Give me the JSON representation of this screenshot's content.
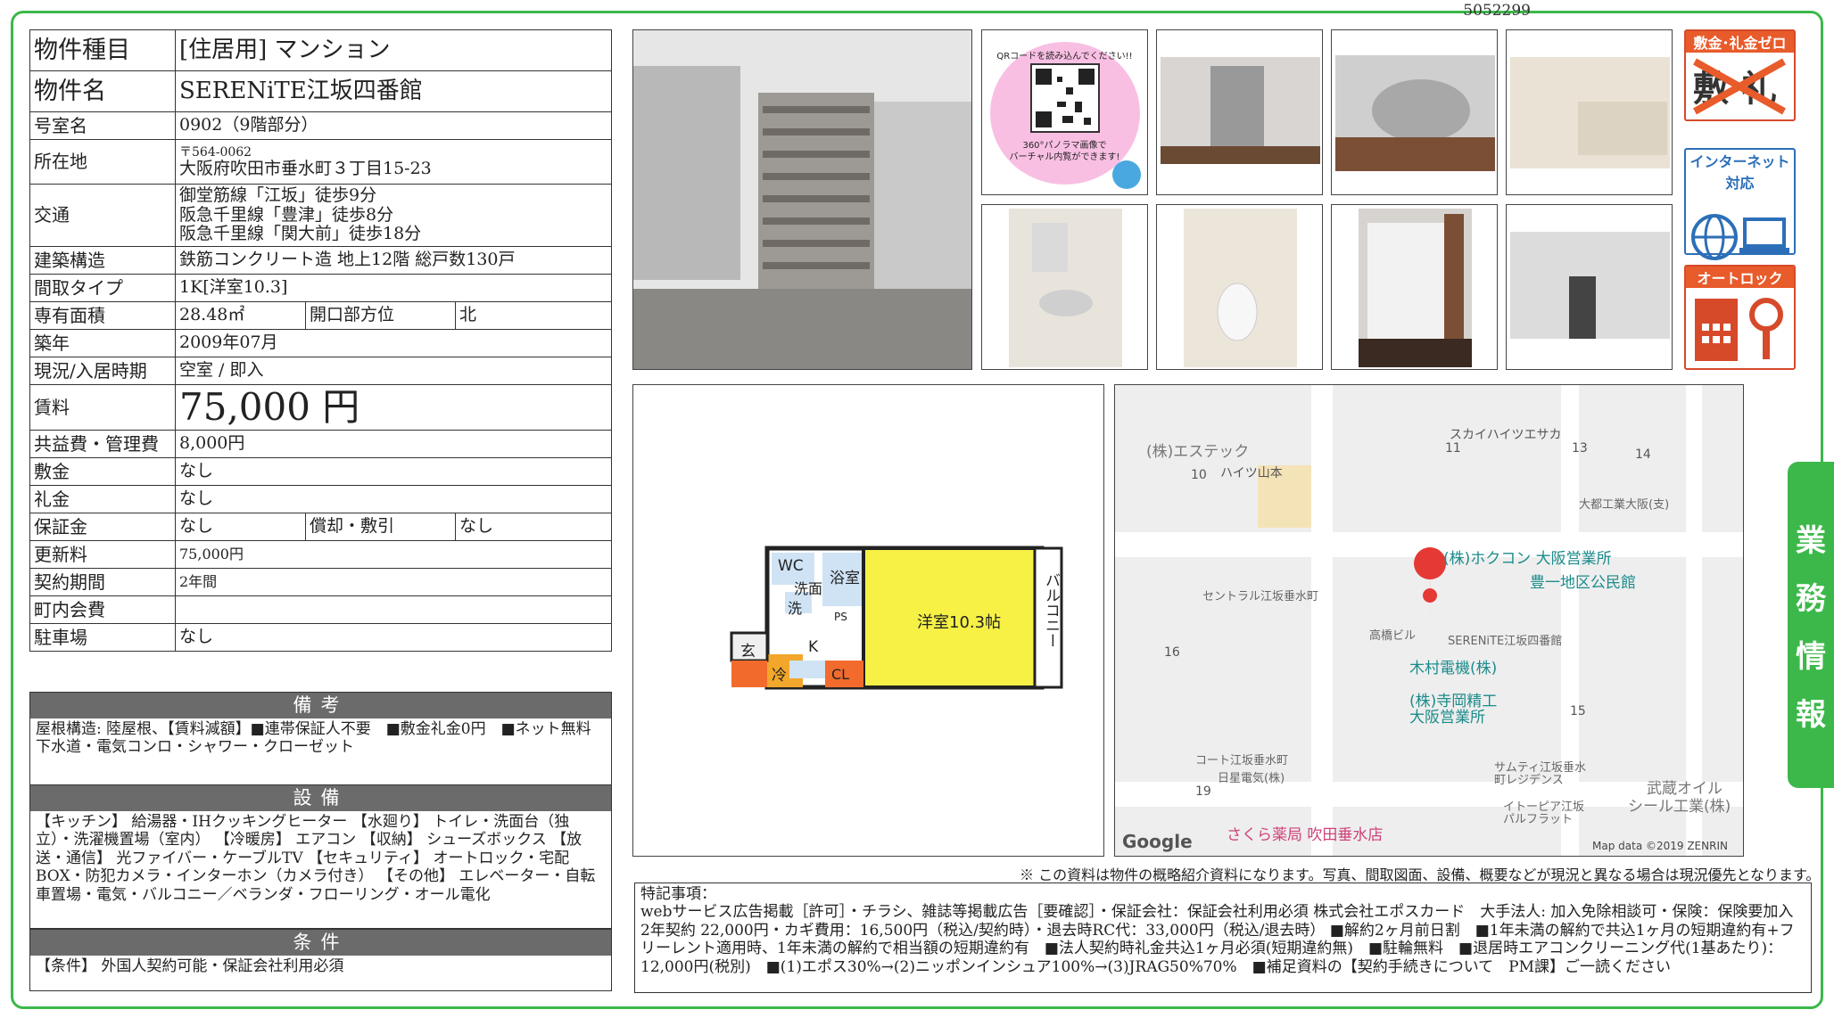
{
  "doc_id": "5052299",
  "table": {
    "type_label": "物件種目",
    "type_value": "[住居用] マンション",
    "name_label": "物件名",
    "name_value": "SERENiTE江坂四番館",
    "room_label": "号室名",
    "room_value": "0902（9階部分）",
    "addr_label": "所在地",
    "postal": "〒564-0062",
    "address": "大阪府吹田市垂水町３丁目15-23",
    "traffic_label": "交通",
    "traffic": [
      "御堂筋線「江坂」徒歩9分",
      "阪急千里線「豊津」徒歩8分",
      "阪急千里線「関大前」徒歩18分"
    ],
    "structure_label": "建築構造",
    "structure_value": "鉄筋コンクリート造 地上12階 総戸数130戸",
    "layout_label": "間取タイプ",
    "layout_value": "1K[洋室10.3]",
    "area_label": "専有面積",
    "area_value": "28.48㎡",
    "direction_label": "開口部方位",
    "direction_value": "北",
    "built_label": "築年",
    "built_value": "2009年07月",
    "status_label": "現況/入居時期",
    "status_value": "空室 / 即入",
    "rent_label": "賃料",
    "rent_value": "75,000 円",
    "fee_label": "共益費・管理費",
    "fee_value": "8,000円",
    "deposit_label": "敷金",
    "deposit_value": "なし",
    "key_label": "礼金",
    "key_value": "なし",
    "guarantee_label": "保証金",
    "guarantee_value": "なし",
    "amort_label": "償却・敷引",
    "amort_value": "なし",
    "renewal_label": "更新料",
    "renewal_value": "75,000円",
    "contract_label": "契約期間",
    "contract_value": "2年間",
    "town_label": "町内会費",
    "town_value": "",
    "parking_label": "駐車場",
    "parking_value": "なし"
  },
  "remarks": {
    "title": "備考",
    "lines": [
      "屋根構造: 陸屋根、【賃料減額】■連帯保証人不要　■敷金礼金0円　■ネット無料",
      "下水道・電気コンロ・シャワー・クローゼット"
    ]
  },
  "equipment": {
    "title": "設備",
    "text": "【キッチン】 給湯器・IHクッキングヒーター 【水廻り】 トイレ・洗面台（独立）・洗濯機置場（室内） 【冷暖房】 エアコン 【収納】 シューズボックス 【放送・通信】 光ファイバー・ケーブルTV 【セキュリティ】 オートロック・宅配BOX・防犯カメラ・インターホン（カメラ付き） 【その他】 エレベーター・自転車置場・電気・バルコニー／ベランダ・フローリング・オール電化"
  },
  "conditions": {
    "title": "条件",
    "text": "【条件】 外国人契約可能・保証会社利用必須"
  },
  "qr": {
    "line1": "QRコードを読み込んでください!!",
    "line2": "360°パノラマ画像で",
    "line3": "バーチャル内覧ができます!"
  },
  "badges": {
    "zero": "敷金･礼金ゼロ",
    "zero_glyphs": "敷 礼",
    "internet": "インターネット対応",
    "autolock": "オートロック"
  },
  "side_tab": [
    "業",
    "務",
    "情",
    "報"
  ],
  "floorplan": {
    "wc": "WC",
    "bath": "浴室",
    "wash": "洗面",
    "laundry": "洗",
    "ps": "PS",
    "entrance": "玄",
    "kitchen": "K",
    "fridge": "冷",
    "closet": "CL",
    "room": "洋室10.3帖",
    "balcony": "バルコニー"
  },
  "map": {
    "labels": [
      "(株)エステック",
      "ハイツ山本",
      "スカイハイツエサカ",
      "大都工業大阪(支)",
      "(株)ホクコン 大阪営業所",
      "豊一地区公民館",
      "セントラル江坂垂水町",
      "高橋ビル",
      "SERENiTE江坂四番館",
      "木村電機(株)",
      "(株)寺岡精工",
      "大阪営業所",
      "コート江坂垂水町",
      "日星電気(株)",
      "サムティ江坂垂水",
      "町レジデンス",
      "武蔵オイル",
      "シール工業(株)",
      "イトーピア江坂",
      "パルフラット",
      "さくら薬局 吹田垂水店"
    ],
    "blocks": [
      "10",
      "11",
      "13",
      "14",
      "16",
      "15",
      "19"
    ],
    "google": "Google",
    "copyright": "Map data ©2019 ZENRIN"
  },
  "note": "※ この資料は物件の概略紹介資料になります。写真、間取図面、設備、概要などが現況と異なる場合は現況優先となります。",
  "special": {
    "title": "特記事項：",
    "text": "webサービス広告掲載［許可］・チラシ、雑誌等掲載広告［要確認］・保証会社：保証会社利用必須 株式会社エポスカード　大手法人: 加入免除相談可・保険：保険要加入 2年契約 22,000円・カギ費用：16,500円（税込/契約時）・退去時RC代：33,000円（税込/退去時） ■解約2ヶ月前日割　■1年未満の解約で共込1ヶ月の短期違約有+フリーレント適用時、1年未満の解約で相当額の短期違約有　■法人契約時礼金共込1ヶ月必須(短期違約無)　■駐輪無料　■退居時エアコンクリーニング代(1基あたり)：12,000円(税別)　■(1)エポス30%→(2)ニッポンインシュア100%→(3)JRAG50%70%　■補足資料の【契約手続きについて　PM課】ご一読ください"
  }
}
